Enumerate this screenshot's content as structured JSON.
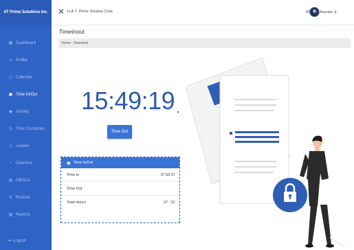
{
  "sidebar": {
    "brand": "AT Prime Solutions Inc.",
    "items": [
      {
        "label": "Dashboard",
        "icon": "grid-icon",
        "glyph": "▦",
        "active": false
      },
      {
        "label": "Profile",
        "icon": "user-icon",
        "glyph": "♙",
        "active": false
      },
      {
        "label": "Calendar",
        "icon": "calendar-icon",
        "glyph": "▢",
        "active": false
      },
      {
        "label": "Time In/Out",
        "icon": "calendar-check-icon",
        "glyph": "▣",
        "active": true
      },
      {
        "label": "Activity",
        "icon": "activity-icon",
        "glyph": "◉",
        "active": false
      },
      {
        "label": "Time Correction",
        "icon": "clock-icon",
        "glyph": "◷",
        "active": false
      },
      {
        "label": "Leaves",
        "icon": "leaf-icon",
        "glyph": "▯",
        "active": false
      },
      {
        "label": "Overtime",
        "icon": "overtime-icon",
        "glyph": "◔",
        "active": false
      },
      {
        "label": "OBSCA",
        "icon": "document-icon",
        "glyph": "▤",
        "active": false
      },
      {
        "label": "Restore",
        "icon": "restore-icon",
        "glyph": "↻",
        "active": false
      },
      {
        "label": "Reports",
        "icon": "report-icon",
        "glyph": "▥",
        "active": false
      }
    ],
    "logout": "Logout"
  },
  "topbar": {
    "company": "H.A.T. Prime Solution Corp.",
    "user": "Ricardo Arevalo Jr"
  },
  "page": {
    "title": "Timeinout",
    "breadcrumb": "Home › Timeinout"
  },
  "clock": {
    "time": "15:49:19",
    "button_label": "Time Out"
  },
  "card": {
    "title": "Time In/Out",
    "rows": [
      {
        "label": "Time In",
        "value": "07:58:07"
      },
      {
        "label": "Time Out",
        "value": ""
      },
      {
        "label": "Total Hours",
        "value": "07 : 52"
      }
    ]
  },
  "colors": {
    "sidebar": "#2f63c6",
    "accent": "#3a74d6",
    "clock_text": "#2e5aa8"
  }
}
